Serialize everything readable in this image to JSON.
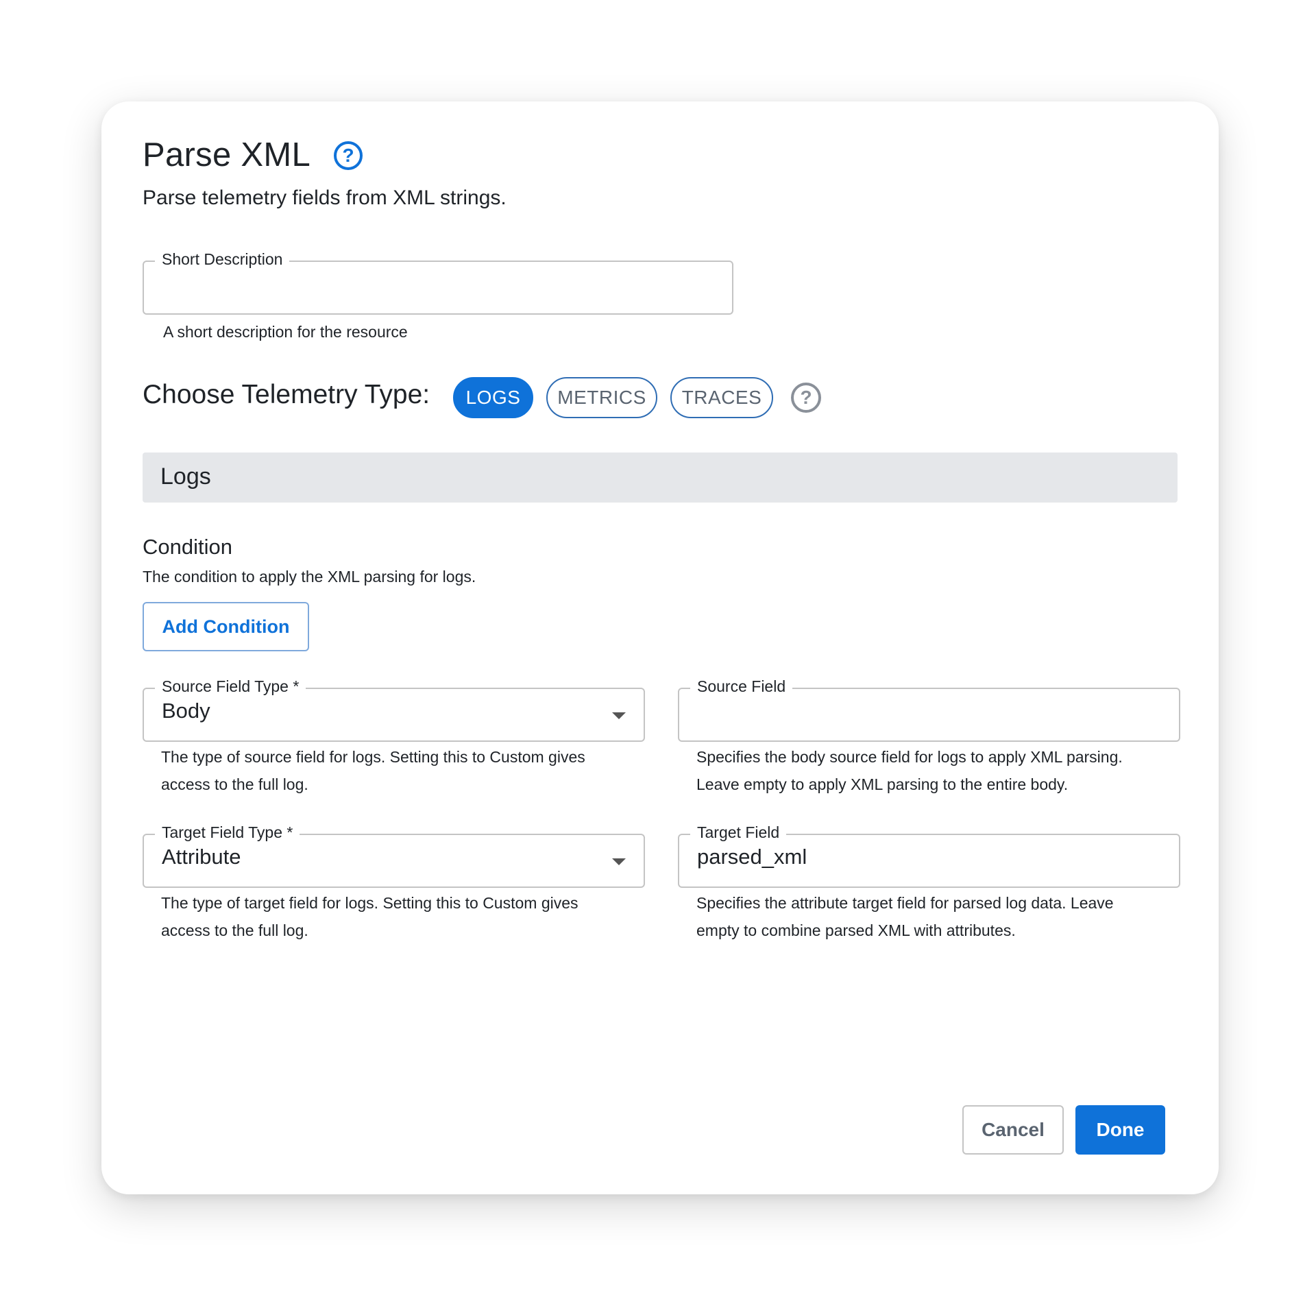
{
  "dialog": {
    "title": "Parse XML",
    "subtitle": "Parse telemetry fields from XML strings.",
    "title_help_icon": "help-circle-icon"
  },
  "short_description": {
    "label": "Short Description",
    "value": "",
    "helper": "A short description for the resource"
  },
  "telemetry": {
    "label": "Choose Telemetry Type:",
    "options": [
      "LOGS",
      "METRICS",
      "TRACES"
    ],
    "selected": "LOGS",
    "help_icon": "help-circle-icon"
  },
  "section": {
    "title": "Logs"
  },
  "condition": {
    "title": "Condition",
    "description": "The condition to apply the XML parsing for logs.",
    "add_button": "Add Condition"
  },
  "fields": {
    "source_field_type": {
      "label": "Source Field Type *",
      "value": "Body",
      "helper_line1": "The type of source field for logs. Setting this to Custom gives",
      "helper_line2": "access to the full log."
    },
    "source_field": {
      "label": "Source Field",
      "value": "",
      "helper_line1": "Specifies the body source field for logs to apply XML parsing.",
      "helper_line2": "Leave empty to apply XML parsing to the entire body."
    },
    "target_field_type": {
      "label": "Target Field Type *",
      "value": "Attribute",
      "helper_line1": "The type of target field for logs. Setting this to Custom gives",
      "helper_line2": "access to the full log."
    },
    "target_field": {
      "label": "Target Field",
      "value": "parsed_xml",
      "helper_line1": "Specifies the attribute target field for parsed log data. Leave",
      "helper_line2": "empty to combine parsed XML with attributes."
    }
  },
  "actions": {
    "cancel": "Cancel",
    "done": "Done"
  },
  "colors": {
    "primary": "#0f72d9",
    "section_bar": "#e5e7ea",
    "border": "#c4c4c4"
  }
}
